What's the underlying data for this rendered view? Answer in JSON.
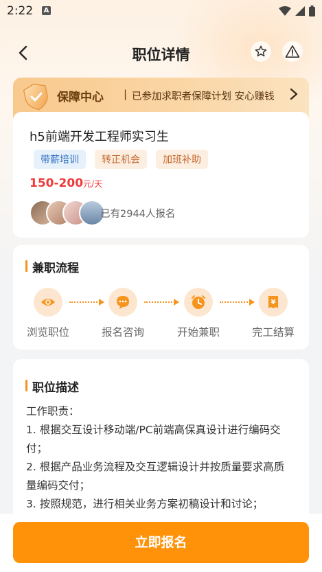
{
  "status_bar": {
    "time": "2:22",
    "notif_letter": "A"
  },
  "nav": {
    "title": "职位详情"
  },
  "guarantee": {
    "title": "保障中心",
    "separator": "|",
    "text": "已参加求职者保障计划 安心赚钱"
  },
  "job": {
    "title": "h5前端开发工程师实习生",
    "tags": [
      {
        "label": "带薪培训",
        "style": "blue"
      },
      {
        "label": "转正机会",
        "style": "orange"
      },
      {
        "label": "加班补助",
        "style": "orange"
      }
    ],
    "salary_range": "150-200",
    "salary_unit": "元/天",
    "signup_text": "已有2944人报名"
  },
  "process": {
    "title": "兼职流程",
    "steps": [
      {
        "label": "浏览职位",
        "icon": "eye-icon"
      },
      {
        "label": "报名咨询",
        "icon": "chat-icon"
      },
      {
        "label": "开始兼职",
        "icon": "clock-icon"
      },
      {
        "label": "完工结算",
        "icon": "yuan-receipt-icon"
      }
    ]
  },
  "description": {
    "title": "职位描述",
    "lines": [
      "工作职责：",
      "1. 根据交互设计移动端/PC前端高保真设计进行编码交",
      "付；",
      "2. 根据产品业务流程及交互逻辑设计并按质量要求高质",
      "量编码交付；",
      "3. 按照规范，进行相关业务方案初稿设计和讨论；"
    ]
  },
  "bottom": {
    "apply_label": "立即报名"
  },
  "colors": {
    "accent": "#ff9209",
    "salary": "#ef3b3b",
    "icon_bg": "#fde6cf"
  }
}
